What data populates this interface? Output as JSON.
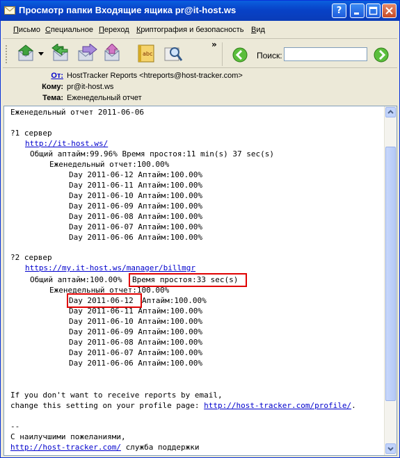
{
  "window": {
    "title": "Просмотр папки Входящие ящика pr@it-host.ws",
    "help_btn": "?",
    "min_btn": "_",
    "max_btn": "□",
    "close_btn": "✕"
  },
  "menu": {
    "items": [
      {
        "label": "Письмо",
        "key": "П"
      },
      {
        "label": "Специальное",
        "key": "С"
      },
      {
        "label": "Переход",
        "key": "П"
      },
      {
        "label": "Криптография и безопасность",
        "key": "К"
      },
      {
        "label": "Вид",
        "key": "В"
      }
    ]
  },
  "toolbar": {
    "tools": [
      "reply-icon",
      "reply-all-icon",
      "forward-icon",
      "redirect-icon",
      "spellcheck-icon",
      "find-icon"
    ],
    "overflow": "»",
    "search_label": "Поиск:",
    "search_value": ""
  },
  "headers": {
    "from_label": "От:",
    "from_value": "HostTracker Reports <htreports@host-tracker.com>",
    "to_label": "Кому:",
    "to_value": "pr@it-host.ws",
    "subject_label": "Тема:",
    "subject_value": "Еженедельный отчет"
  },
  "message": {
    "heading": "Еженедельный отчет 2011-06-06",
    "server1": {
      "title": "?1 сервер",
      "url": "http://it-host.ws/",
      "summary": "Общий аптайм:99.96% Время простоя:11 min(s) 37 sec(s)",
      "weekly": "Еженедельный отчет:100.00%",
      "days": [
        "Day 2011-06-12 Аптайм:100.00%",
        "Day 2011-06-11 Аптайм:100.00%",
        "Day 2011-06-10 Аптайм:100.00%",
        "Day 2011-06-09 Аптайм:100.00%",
        "Day 2011-06-08 Аптайм:100.00%",
        "Day 2011-06-07 Аптайм:100.00%",
        "Day 2011-06-06 Аптайм:100.00%"
      ]
    },
    "server2": {
      "title": "?2 сервер",
      "url": "https://my.it-host.ws/manager/billmgr",
      "uptime": "Общий аптайм:100.00%",
      "downtime": "Время простоя:33 sec(s)",
      "weekly": "Еженедельный отчет:100.00%",
      "first_day": "Day 2011-06-12",
      "first_uptime": "Аптайм:100.00%",
      "days": [
        "Day 2011-06-11 Аптайм:100.00%",
        "Day 2011-06-10 Аптайм:100.00%",
        "Day 2011-06-09 Аптайм:100.00%",
        "Day 2011-06-08 Аптайм:100.00%",
        "Day 2011-06-07 Аптайм:100.00%",
        "Day 2011-06-06 Аптайм:100.00%"
      ]
    },
    "footer1": "If you don't want to receive reports by email,",
    "footer2": "change this setting on your profile page:",
    "footer_link": "http://host-tracker.com/profile/",
    "footer_dot": ".",
    "sig_dash": "--",
    "sig_line": "С наилучшими пожеланиями,",
    "sig_link": "http://host-tracker.com/",
    "sig_tail": "служба поддержки"
  },
  "colors": {
    "title_bar": "#0842C7",
    "link": "#0000CC",
    "highlight_box": "#E00000"
  }
}
